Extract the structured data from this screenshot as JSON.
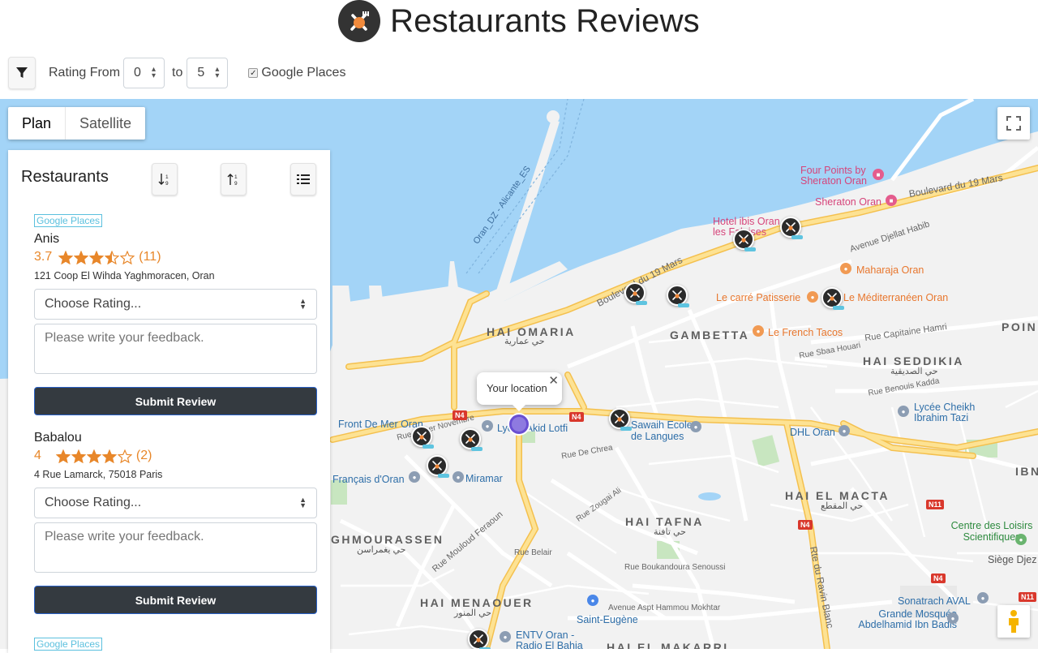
{
  "header": {
    "title": "Restaurants Reviews",
    "logo_icon": "fork-knife-icon",
    "logo_color": "#333333",
    "accent": "#f08a3c"
  },
  "toolbar": {
    "filter_icon": "filter-icon",
    "rating_from_label": "Rating From",
    "rating_from_value": "0",
    "to_label": "to",
    "rating_to_value": "5",
    "google_places_label": "Google Places",
    "google_places_checked": true
  },
  "map": {
    "type_tabs": [
      "Plan",
      "Satellite"
    ],
    "selected_tab": "Plan",
    "popup_text": "Your location",
    "popup_close": "✕",
    "districts": [
      "HAI OMARIA",
      "GAMBETTA",
      "HAI SEDDIKIA",
      "HAI EL MACTA",
      "HAI TAFNA",
      "GHMOURASSEN",
      "HAI MENAOUER",
      "HAI EL MAKARRI",
      "POIN",
      "IBN"
    ],
    "arabic_labels": [
      "حي عمارية",
      "حي الصديقية",
      "حي المقطع",
      "حي تافنة",
      "حي يغمراسن",
      "حي المنور"
    ],
    "places": {
      "four_points": "Four Points by Sheraton Oran",
      "sheraton": "Sheraton Oran",
      "ibis": "Hotel ibis Oran les Falaises",
      "maharaja": "Maharaja Oran",
      "carre": "Le carré Patisserie",
      "mediterraneen": "Le Méditerranéen Oran",
      "french_tacos": "Le French Tacos",
      "fronts": "Front De Mer Oran",
      "lycee_akid": "Lycée Akid Lotfi",
      "sawaih": "Sawaih Ecole de Langues",
      "dhl": "DHL Oran",
      "lycee_cheikh": "Lycée Cheikh Ibrahim Tazi",
      "francais": "Français d'Oran",
      "miramar": "Miramar",
      "centre_loisirs": "Centre des Loisirs Scientifiques",
      "siege": "Siège Djez",
      "sonatrach": "Sonatrach AVAL",
      "grande_mosquee": "Grande Mosquée Abdelhamid Ibn Badis",
      "saint_eugene": "Saint-Eugène",
      "entv": "ENTV Oran - Radio El Bahia"
    },
    "streets": [
      "Boulevard du 19 Mars",
      "Boulevard du 19 Mars",
      "Avenue Djellat Habib",
      "Rue Capitaine Hamri",
      "Rue Mouloud Feraoun",
      "Rte du Ravin Blanc",
      "Oran_DZ - Alicante_ES",
      "Avenue Aspt Hammou Mokhtar",
      "Rue Zougai Ali",
      "Rue De Chrea",
      "Rue Boukandoura Senoussi",
      "Rue Belair",
      "Rue du 1er Novembre",
      "Rue Benouis Kadda",
      "Rue Sbaa Houari"
    ],
    "roads": [
      "N4",
      "N4",
      "N4",
      "N4",
      "N11",
      "N11"
    ],
    "controls": {
      "fullscreen_icon": "fullscreen-icon",
      "pegman_icon": "pegman-icon"
    },
    "colors": {
      "water": "#a3d4f7",
      "land": "#f2f2f2",
      "road": "#fde293",
      "road_border": "#f4c04e",
      "street": "#ffffff",
      "green": "#c8e6c0"
    }
  },
  "sidebar": {
    "title": "Restaurants",
    "sort_asc_icon": "sort-numeric-down-icon",
    "sort_desc_icon": "sort-numeric-up-icon",
    "list_icon": "list-icon",
    "restaurants": [
      {
        "source": "Google Places",
        "name": "Anis",
        "rating": "3.7",
        "stars": 3.5,
        "count": "(11)",
        "address": "121 Coop El Wihda Yaghmoracen, Oran",
        "select_placeholder": "Choose Rating...",
        "feedback_placeholder": "Please write your feedback.",
        "submit_label": "Submit Review"
      },
      {
        "source": "",
        "name": "Babalou",
        "rating": "4",
        "stars": 4,
        "count": "(2)",
        "address": "4 Rue Lamarck, 75018 Paris",
        "select_placeholder": "Choose Rating...",
        "feedback_placeholder": "Please write your feedback.",
        "submit_label": "Submit Review"
      },
      {
        "source": "Google Places"
      }
    ],
    "star_color": "#e8872a"
  }
}
